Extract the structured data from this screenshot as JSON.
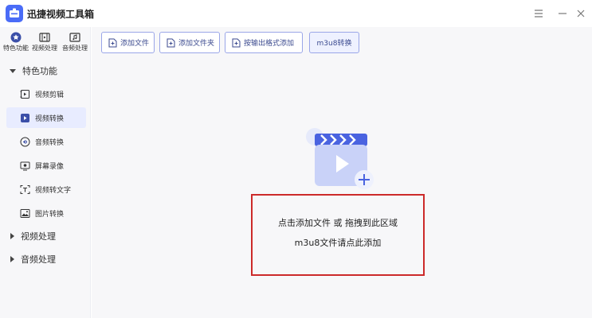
{
  "window": {
    "title": "迅捷视频工具箱",
    "controls": [
      "menu-icon",
      "minimize-icon",
      "close-icon"
    ]
  },
  "top_tabs": [
    {
      "label": "特色功能",
      "icon": "star-icon"
    },
    {
      "label": "视频处理",
      "icon": "film-icon"
    },
    {
      "label": "音频处理",
      "icon": "music-icon"
    }
  ],
  "sidebar": {
    "groups": [
      {
        "label": "特色功能",
        "expanded": true,
        "items": [
          {
            "label": "视频剪辑",
            "icon": "video-edit-icon"
          },
          {
            "label": "视频转换",
            "icon": "video-convert-icon",
            "active": true
          },
          {
            "label": "音频转换",
            "icon": "audio-convert-icon"
          },
          {
            "label": "屏幕录像",
            "icon": "screen-record-icon"
          },
          {
            "label": "视频转文字",
            "icon": "video-to-text-icon"
          },
          {
            "label": "图片转换",
            "icon": "image-convert-icon"
          }
        ]
      },
      {
        "label": "视频处理",
        "expanded": false
      },
      {
        "label": "音频处理",
        "expanded": false
      }
    ]
  },
  "toolbar": {
    "buttons": [
      {
        "label": "添加文件",
        "icon": "add-file-icon"
      },
      {
        "label": "添加文件夹",
        "icon": "add-folder-icon"
      },
      {
        "label": "按输出格式添加",
        "icon": "add-by-format-icon"
      },
      {
        "label": "m3u8转换"
      }
    ]
  },
  "drop_zone": {
    "line1": "点击添加文件 或 拖拽到此区域",
    "line2": "m3u8文件请点此添加",
    "icon": "video-add-icon"
  },
  "colors": {
    "accent": "#4a6cf7",
    "button_border": "#9aa6e8",
    "highlight_frame": "#cc2a2a",
    "active_item_bg": "#e8ecff"
  }
}
